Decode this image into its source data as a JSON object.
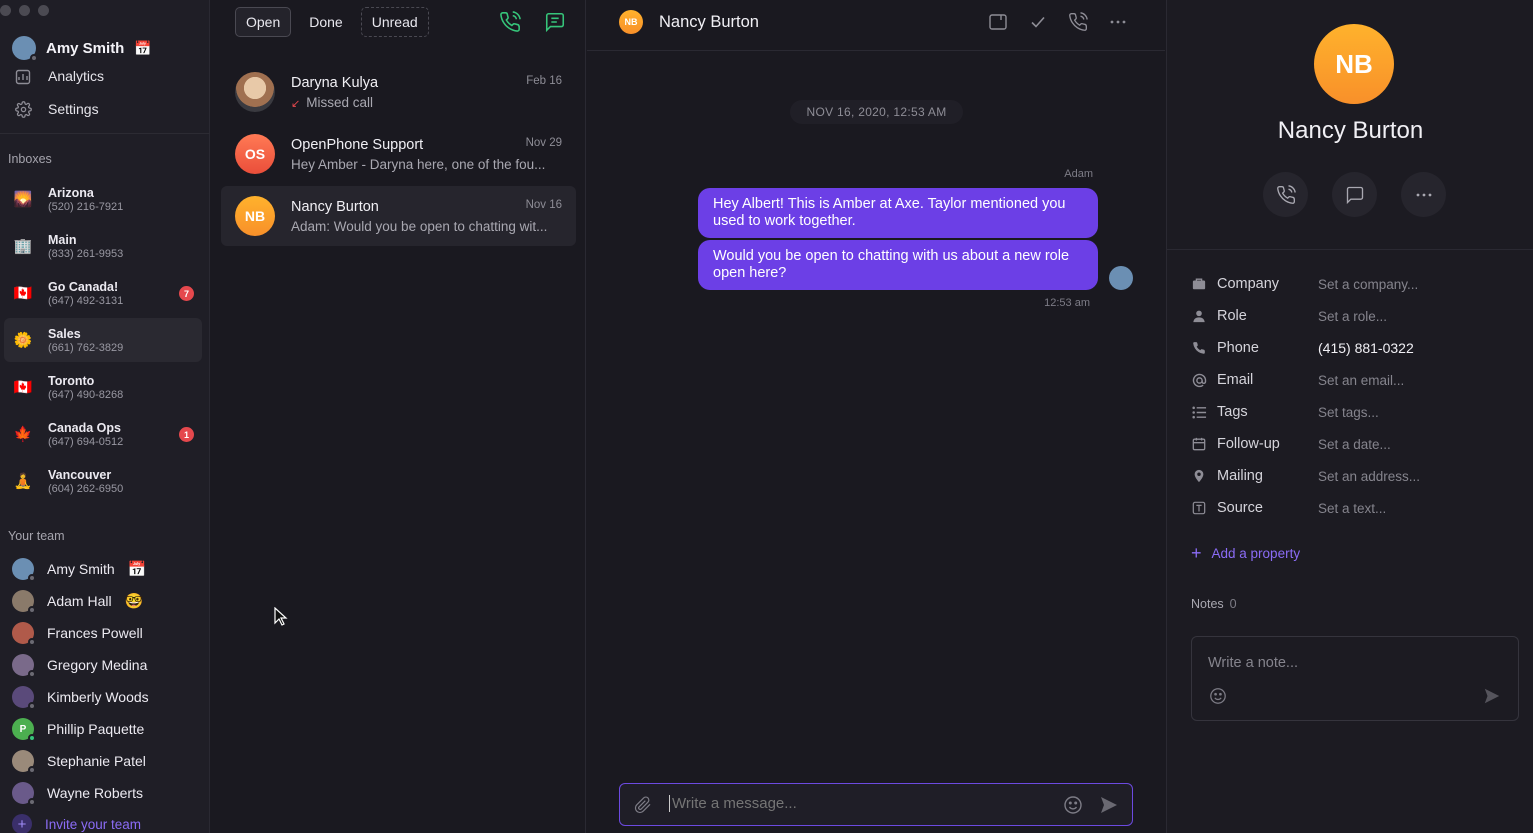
{
  "user": {
    "name": "Amy Smith",
    "status_emoji": "📅"
  },
  "nav": [
    {
      "label": "Analytics",
      "icon": "chart-icon"
    },
    {
      "label": "Settings",
      "icon": "gear-icon"
    }
  ],
  "inboxes_title": "Inboxes",
  "inboxes": [
    {
      "name": "Arizona",
      "phone": "(520) 216-7921",
      "emoji": "🌄"
    },
    {
      "name": "Main",
      "phone": "(833) 261-9953",
      "emoji": "🏢"
    },
    {
      "name": "Go Canada!",
      "phone": "(647) 492-3131",
      "emoji": "🇨🇦",
      "badge": "7"
    },
    {
      "name": "Sales",
      "phone": "(661) 762-3829",
      "emoji": "🌼"
    },
    {
      "name": "Toronto",
      "phone": "(647) 490-8268",
      "emoji": "🇨🇦"
    },
    {
      "name": "Canada Ops",
      "phone": "(647) 694-0512",
      "emoji": "🍁",
      "badge": "1"
    },
    {
      "name": "Vancouver",
      "phone": "(604) 262-6950",
      "emoji": "🧘"
    }
  ],
  "team_title": "Your team",
  "team": [
    {
      "name": "Amy Smith",
      "emoji": "📅",
      "color": "#6b8fb3"
    },
    {
      "name": "Adam Hall",
      "emoji": "🤓",
      "color": "#8a7a6a"
    },
    {
      "name": "Frances Powell",
      "emoji": "",
      "color": "#b05a4a"
    },
    {
      "name": "Gregory Medina",
      "emoji": "",
      "color": "#7a6a8a"
    },
    {
      "name": "Kimberly Woods",
      "emoji": "",
      "color": "#5a4a7a"
    },
    {
      "name": "Phillip Paquette",
      "emoji": "",
      "color": "#4caf50",
      "initial": "P",
      "online": true
    },
    {
      "name": "Stephanie Patel",
      "emoji": "",
      "color": "#9a8a7a"
    },
    {
      "name": "Wayne Roberts",
      "emoji": "",
      "color": "#6a5a8a"
    }
  ],
  "invite_label": "Invite your team",
  "tabs": [
    "Open",
    "Done",
    "Unread"
  ],
  "conversations": [
    {
      "name": "Daryna Kulya",
      "preview": "Missed call",
      "date": "Feb 16",
      "missed": true,
      "color": "#c9a88a"
    },
    {
      "name": "OpenPhone Support",
      "preview": "Hey Amber - Daryna here, one of the fou...",
      "date": "Nov 29",
      "initials": "OS",
      "color": "#f0614a"
    },
    {
      "name": "Nancy Burton",
      "preview": "Adam: Would you be open to chatting wit...",
      "date": "Nov 16",
      "initials": "NB",
      "color": "#f7a02a"
    }
  ],
  "chat": {
    "title": "Nancy Burton",
    "initials": "NB",
    "date_divider": "NOV 16, 2020, 12:53 AM",
    "sender": "Adam",
    "messages": [
      "Hey Albert! This is Amber at Axe. Taylor mentioned you used to work together.",
      "Would you be open to chatting with us about a new role open here?"
    ],
    "time": "12:53 am",
    "composer_placeholder": "Write a message..."
  },
  "contact": {
    "initials": "NB",
    "name": "Nancy Burton",
    "properties": [
      {
        "label": "Company",
        "value": "Set a company...",
        "icon": "briefcase-icon"
      },
      {
        "label": "Role",
        "value": "Set a role...",
        "icon": "person-icon"
      },
      {
        "label": "Phone",
        "value": "(415) 881-0322",
        "icon": "phone-icon",
        "filled": true
      },
      {
        "label": "Email",
        "value": "Set an email...",
        "icon": "at-icon"
      },
      {
        "label": "Tags",
        "value": "Set tags...",
        "icon": "list-icon"
      },
      {
        "label": "Follow-up",
        "value": "Set a date...",
        "icon": "calendar-icon"
      },
      {
        "label": "Mailing",
        "value": "Set an address...",
        "icon": "pin-icon"
      },
      {
        "label": "Source",
        "value": "Set a text...",
        "icon": "text-icon"
      }
    ],
    "add_property": "Add a property",
    "notes_label": "Notes",
    "notes_count": "0",
    "note_placeholder": "Write a note..."
  }
}
